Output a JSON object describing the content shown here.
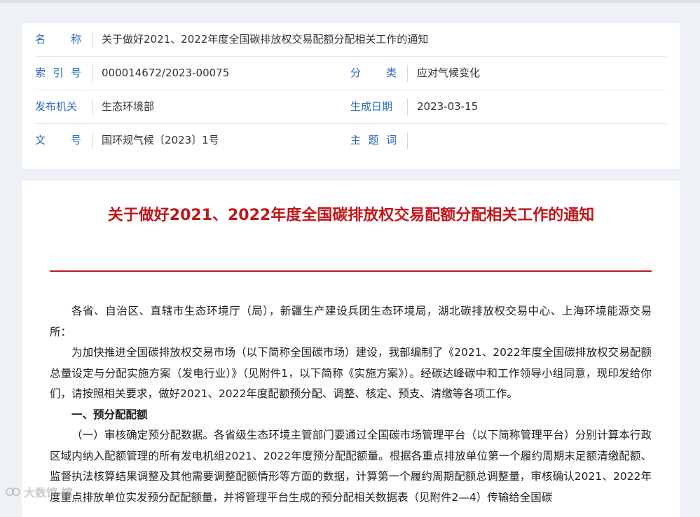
{
  "meta": {
    "rows": [
      {
        "label": "名称",
        "value": "关于做好2021、2022年度全国碳排放权交易配额分配相关工作的通知"
      },
      {
        "label": "索引号",
        "value": "000014672/2023-00075",
        "label2": "分类",
        "value2": "应对气候变化"
      },
      {
        "label": "发布机关",
        "value": "生态环境部",
        "label2": "生成日期",
        "value2": "2023-03-15"
      },
      {
        "label": "文号",
        "value": "国环规气候〔2023〕1号",
        "label2": "主题词",
        "value2": ""
      }
    ]
  },
  "article": {
    "title": "关于做好2021、2022年度全国碳排放权交易配额分配相关工作的通知",
    "paragraphs": [
      "各省、自治区、直辖市生态环境厅（局），新疆生产建设兵团生态环境局，湖北碳排放权交易中心、上海环境能源交易所：",
      "为加快推进全国碳排放权交易市场（以下简称全国碳市场）建设，我部编制了《2021、2022年度全国碳排放权交易配额总量设定与分配实施方案（发电行业）》（见附件1，以下简称《实施方案》）。经碳达峰碳中和工作领导小组同意，现印发给你们，请按照相关要求，做好2021、2022年度配额预分配、调整、核定、预支、清缴等各项工作。",
      "一、预分配配额",
      "（一）审核确定预分配数据。各省级生态环境主管部门要通过全国碳市场管理平台（以下简称管理平台）分别计算本行政区域内纳入配额管理的所有发电机组2021、2022年度预分配配额量。根据各重点排放单位第一个履约周期末足额清缴配额、监督执法核算结果调整及其他需要调整配额情形等方面的数据，计算第一个履约周期配额总调整量，审核确认2021、2022年度重点排放单位实发预分配配额量，并将管理平台生成的预分配相关数据表（见附件2—4）传输给全国碳"
    ]
  },
  "watermark": {
    "text": "大数馆 馆"
  },
  "colors": {
    "label": "#2b6bb8",
    "title": "#c0171a",
    "text": "#222222"
  }
}
